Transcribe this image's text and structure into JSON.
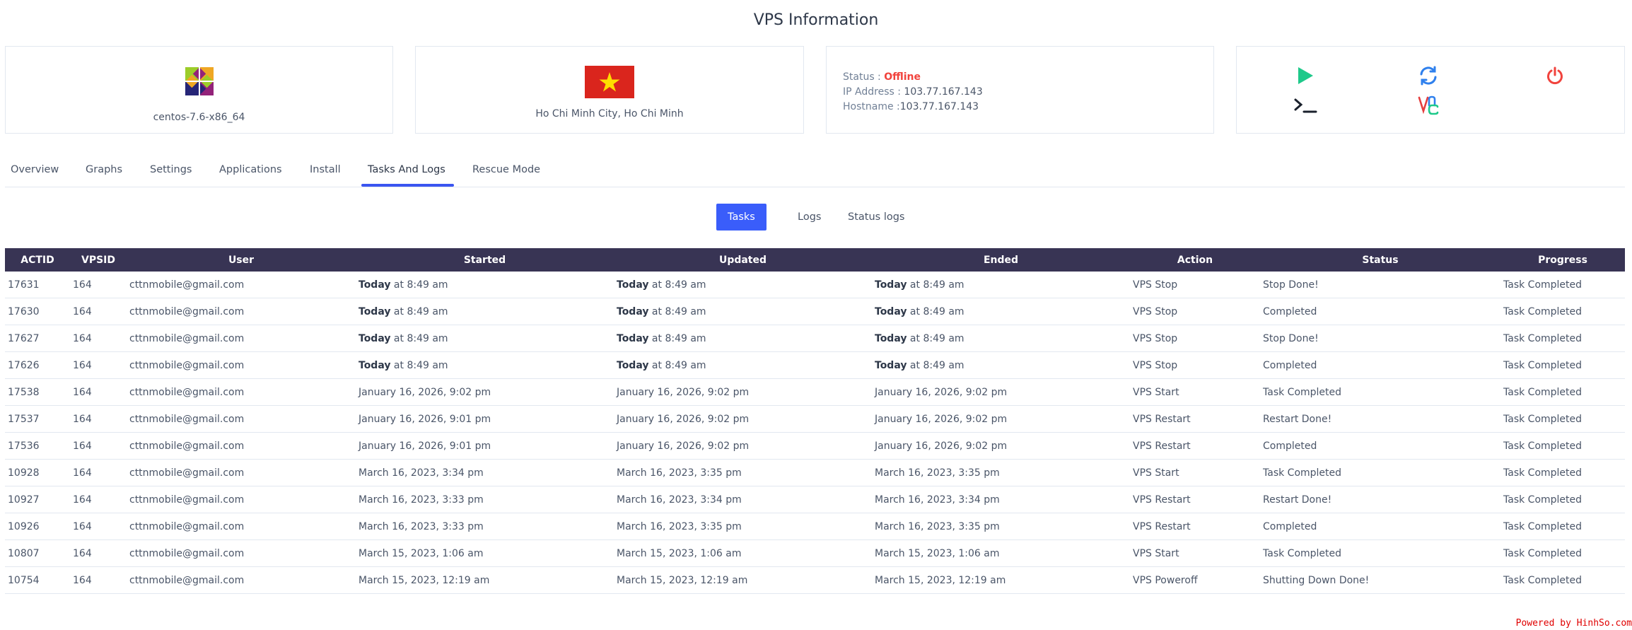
{
  "page_title": "VPS Information",
  "os_card": {
    "name": "centos-7.6-x86_64",
    "icon": "centos-logo-icon"
  },
  "location_card": {
    "name": "Ho Chi Minh City, Ho Chi Minh",
    "icon": "vietnam-flag-icon"
  },
  "status_card": {
    "status_label": "Status :",
    "status_value": "Offline",
    "status_color": "#f1433d",
    "ip_label": "IP Address :",
    "ip_value": "103.77.167.143",
    "hostname_label": "Hostname :",
    "hostname_value": "103.77.167.143"
  },
  "actions": [
    {
      "icon": "play-icon",
      "color": "#1ec98a"
    },
    {
      "icon": "restart-icon",
      "color": "#2f80ed"
    },
    {
      "icon": "power-icon",
      "color": "#f1433d"
    },
    {
      "icon": "terminal-icon",
      "color": "#1a202c"
    },
    {
      "icon": "vnc-icon",
      "color": "#e53e3e"
    }
  ],
  "tabs": [
    {
      "label": "Overview"
    },
    {
      "label": "Graphs"
    },
    {
      "label": "Settings"
    },
    {
      "label": "Applications"
    },
    {
      "label": "Install"
    },
    {
      "label": "Tasks And Logs",
      "active": true
    },
    {
      "label": "Rescue Mode"
    }
  ],
  "subtabs": [
    {
      "label": "Tasks",
      "active": true
    },
    {
      "label": "Logs"
    },
    {
      "label": "Status logs"
    }
  ],
  "table": {
    "columns": [
      "ACTID",
      "VPSID",
      "User",
      "Started",
      "Updated",
      "Ended",
      "Action",
      "Status",
      "Progress"
    ],
    "rows": [
      [
        "17631",
        "164",
        "cttnmobile@gmail.com",
        "Today| at 8:49 am",
        "Today| at 8:49 am",
        "Today| at 8:49 am",
        "VPS Stop",
        "Stop Done!",
        "Task Completed"
      ],
      [
        "17630",
        "164",
        "cttnmobile@gmail.com",
        "Today| at 8:49 am",
        "Today| at 8:49 am",
        "Today| at 8:49 am",
        "VPS Stop",
        "Completed",
        "Task Completed"
      ],
      [
        "17627",
        "164",
        "cttnmobile@gmail.com",
        "Today| at 8:49 am",
        "Today| at 8:49 am",
        "Today| at 8:49 am",
        "VPS Stop",
        "Stop Done!",
        "Task Completed"
      ],
      [
        "17626",
        "164",
        "cttnmobile@gmail.com",
        "Today| at 8:49 am",
        "Today| at 8:49 am",
        "Today| at 8:49 am",
        "VPS Stop",
        "Completed",
        "Task Completed"
      ],
      [
        "17538",
        "164",
        "cttnmobile@gmail.com",
        "January 16, 2026, 9:02 pm",
        "January 16, 2026, 9:02 pm",
        "January 16, 2026, 9:02 pm",
        "VPS Start",
        "Task Completed",
        "Task Completed"
      ],
      [
        "17537",
        "164",
        "cttnmobile@gmail.com",
        "January 16, 2026, 9:01 pm",
        "January 16, 2026, 9:02 pm",
        "January 16, 2026, 9:02 pm",
        "VPS Restart",
        "Restart Done!",
        "Task Completed"
      ],
      [
        "17536",
        "164",
        "cttnmobile@gmail.com",
        "January 16, 2026, 9:01 pm",
        "January 16, 2026, 9:02 pm",
        "January 16, 2026, 9:02 pm",
        "VPS Restart",
        "Completed",
        "Task Completed"
      ],
      [
        "10928",
        "164",
        "cttnmobile@gmail.com",
        "March 16, 2023, 3:34 pm",
        "March 16, 2023, 3:35 pm",
        "March 16, 2023, 3:35 pm",
        "VPS Start",
        "Task Completed",
        "Task Completed"
      ],
      [
        "10927",
        "164",
        "cttnmobile@gmail.com",
        "March 16, 2023, 3:33 pm",
        "March 16, 2023, 3:34 pm",
        "March 16, 2023, 3:34 pm",
        "VPS Restart",
        "Restart Done!",
        "Task Completed"
      ],
      [
        "10926",
        "164",
        "cttnmobile@gmail.com",
        "March 16, 2023, 3:33 pm",
        "March 16, 2023, 3:35 pm",
        "March 16, 2023, 3:35 pm",
        "VPS Restart",
        "Completed",
        "Task Completed"
      ],
      [
        "10807",
        "164",
        "cttnmobile@gmail.com",
        "March 15, 2023, 1:06 am",
        "March 15, 2023, 1:06 am",
        "March 15, 2023, 1:06 am",
        "VPS Start",
        "Task Completed",
        "Task Completed"
      ],
      [
        "10754",
        "164",
        "cttnmobile@gmail.com",
        "March 15, 2023, 12:19 am",
        "March 15, 2023, 12:19 am",
        "March 15, 2023, 12:19 am",
        "VPS Poweroff",
        "Shutting Down Done!",
        "Task Completed"
      ]
    ]
  },
  "footer": {
    "powered_by": "Powered by HinhSo.com"
  }
}
